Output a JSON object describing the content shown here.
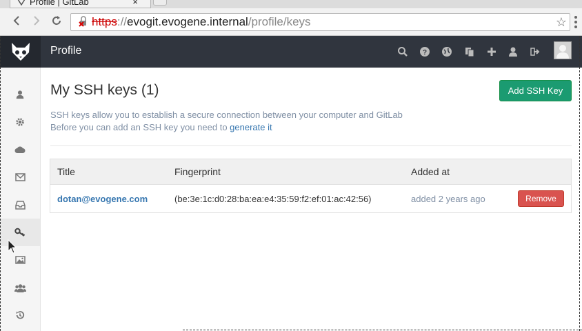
{
  "browser": {
    "tab_title": "Profile | GitLab",
    "tab_close": "×",
    "url_scheme": "https",
    "url_separator": "://",
    "url_host": "evogit.evogene.internal",
    "url_path": "/profile/keys"
  },
  "header": {
    "title": "Profile",
    "icons": [
      "search-icon",
      "help-icon",
      "explore-icon",
      "snippets-icon",
      "new-project-icon",
      "profile-icon",
      "sign-out-icon"
    ]
  },
  "sidebar": {
    "items": [
      {
        "icon": "user-icon"
      },
      {
        "icon": "gear-icon"
      },
      {
        "icon": "cloud-icon"
      },
      {
        "icon": "envelope-icon"
      },
      {
        "icon": "inbox-icon"
      },
      {
        "icon": "key-icon",
        "active": true
      },
      {
        "icon": "image-icon"
      },
      {
        "icon": "users-icon"
      },
      {
        "icon": "history-icon"
      }
    ]
  },
  "main": {
    "title": "My SSH keys (1)",
    "add_button": "Add SSH Key",
    "desc_line1": "SSH keys allow you to establish a secure connection between your computer and GitLab",
    "desc_line2_prefix": "Before you can add an SSH key you need to ",
    "desc_link": "generate it",
    "table": {
      "headers": [
        "Title",
        "Fingerprint",
        "Added at"
      ],
      "rows": [
        {
          "title": "dotan@evogene.com",
          "fingerprint": "(be:3e:1c:d0:28:ba:ea:e4:35:59:f2:ef:01:ac:42:56)",
          "added": "added 2 years ago",
          "action": "Remove"
        }
      ]
    }
  },
  "colors": {
    "header_bg": "#30353e",
    "add_button": "#1b9b71",
    "remove_button": "#d9534f",
    "link": "#3777b0"
  }
}
